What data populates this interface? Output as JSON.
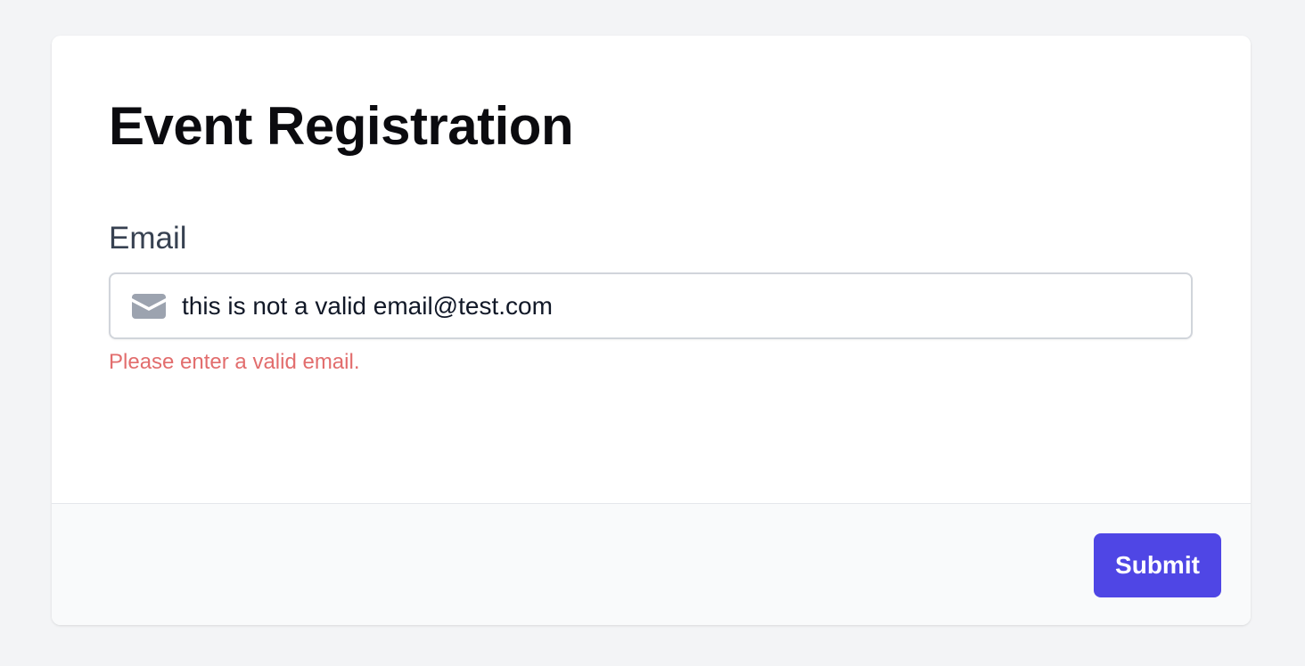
{
  "form": {
    "title": "Event Registration",
    "email_label": "Email",
    "email_value": "this is not a valid email@test.com",
    "email_icon": "mail-icon",
    "error_message": "Please enter a valid email.",
    "submit_label": "Submit"
  },
  "colors": {
    "page_background": "#f3f4f6",
    "card_background": "#ffffff",
    "footer_background": "#f9fafb",
    "accent": "#4f46e5",
    "error": "#e26d6d",
    "icon": "#9ca3af"
  }
}
